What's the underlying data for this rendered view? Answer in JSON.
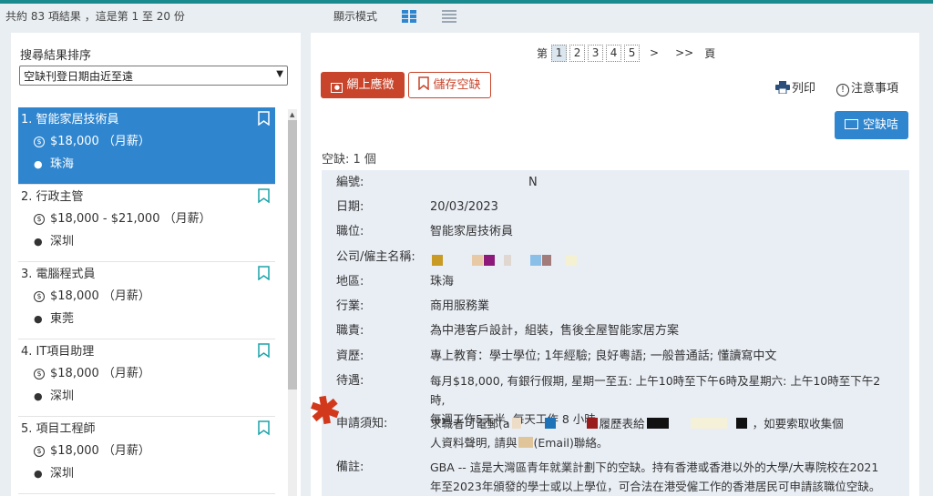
{
  "topbar": {
    "result_count": "共約 83 項結果 ，這是第 1 至 20 份",
    "display_mode_label": "顯示模式"
  },
  "sort": {
    "label": "搜尋結果排序",
    "selected": "空缺刊登日期由近至遠"
  },
  "jobs": [
    {
      "title": "1. 智能家居技術員",
      "salary": "$18,000 （月薪）",
      "location": "珠海"
    },
    {
      "title": "2. 行政主管",
      "salary": "$18,000 - $21,000 （月薪）",
      "location": "深圳"
    },
    {
      "title": "3. 電腦程式員",
      "salary": "$18,000 （月薪）",
      "location": "東莞"
    },
    {
      "title": "4. IT項目助理",
      "salary": "$18,000 （月薪）",
      "location": "深圳"
    },
    {
      "title": "5. 項目工程師",
      "salary": "$18,000 （月薪）",
      "location": "深圳"
    }
  ],
  "pager": {
    "prefix": "第",
    "pages": [
      "1",
      "2",
      "3",
      "4",
      "5"
    ],
    "next": ">",
    "last": ">>",
    "suffix": "頁"
  },
  "actions": {
    "apply": "網上應徵",
    "save": "儲存空缺",
    "print": "列印",
    "notice": "注意事項",
    "vacancy_card": "空缺咭"
  },
  "vacancy_count": "空缺: 1 個",
  "details": {
    "id_label": "編號:",
    "id_value": "N",
    "date_label": "日期:",
    "date_value": "20/03/2023",
    "position_label": "職位:",
    "position_value": "智能家居技術員",
    "company_label": "公司/僱主名稱:",
    "region_label": "地區:",
    "region_value": "珠海",
    "industry_label": "行業:",
    "industry_value": "商用服務業",
    "duty_label": "職責:",
    "duty_value": "為中港客戶設計，組裝，售後全屋智能家居方案",
    "exp_label": "資歷:",
    "exp_value": "專上教育：學士學位; 1年經驗; 良好粵語; 一般普通話; 懂讀寫中文",
    "pay_label": "待遇:",
    "pay_value_1": "每月$18,000, 有銀行假期, 星期一至五: 上午10時至下午6時及星期六: 上午10時至下午2時,",
    "pay_value_2": "每週工作5天半, 每天工作 8 小時",
    "apply_label": "申請須知:",
    "apply_value_1a": "求職者可電郵(a",
    "apply_value_1b": "履歷表給",
    "apply_value_1c": "，如要索取收集個",
    "apply_value_2a": "人資料聲明, 請與",
    "apply_value_2b": "(Email)聯絡。",
    "remark_label": "備註:",
    "remark_value_1": "GBA -- 這是大灣區青年就業計劃下的空缺。持有香港或香港以外的大學/大專院校在2021",
    "remark_value_2": "年至2023年頒發的學士或以上學位，可合法在港受僱工作的香港居民可申請該職位空缺。"
  },
  "colors": {
    "accent_blue": "#2f86cf",
    "apply_red": "#c8442a",
    "teal_strip": "#1a8a8e"
  }
}
